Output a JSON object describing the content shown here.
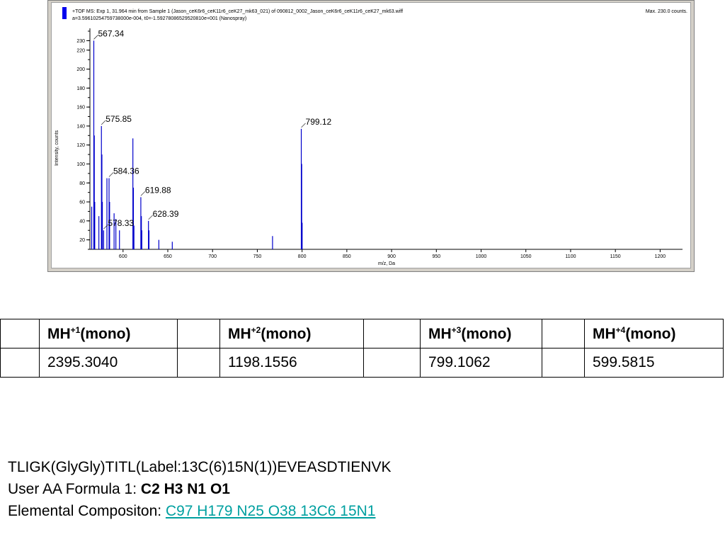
{
  "spectrum": {
    "header_line1": "+TOF MS: Exp 1, 31.964 min from Sample 1 (Jason_ceK6r6_ceK11r6_ceK27_mk63_021) of 090812_0002_Jason_ceK6r6_ceK11r6_ceK27_mk63.wiff",
    "header_line2": "a=3.59610254759738000e-004, t0=-1.59278086529520810e+001 (Nanospray)",
    "max_label": "Max. 230.0 counts.",
    "ylabel": "Intensity, counts",
    "xlabel": "m/z, Da"
  },
  "chart_data": {
    "type": "line",
    "title": "+TOF MS: Exp 1, 31.964 min from Sample 1",
    "xlabel": "m/z, Da",
    "ylabel": "Intensity, counts",
    "xlim": [
      563,
      1225
    ],
    "ylim": [
      10,
      240
    ],
    "x_ticks": [
      600,
      650,
      700,
      750,
      800,
      850,
      900,
      950,
      1000,
      1050,
      1100,
      1150,
      1200
    ],
    "y_ticks": [
      20,
      40,
      60,
      80,
      100,
      120,
      140,
      160,
      180,
      200,
      220,
      230
    ],
    "peaks": [
      {
        "mz": 565.0,
        "intensity": 55
      },
      {
        "mz": 567.34,
        "intensity": 230
      },
      {
        "mz": 567.9,
        "intensity": 130
      },
      {
        "mz": 568.4,
        "intensity": 60
      },
      {
        "mz": 573.0,
        "intensity": 45
      },
      {
        "mz": 575.85,
        "intensity": 140
      },
      {
        "mz": 576.4,
        "intensity": 110
      },
      {
        "mz": 576.9,
        "intensity": 60
      },
      {
        "mz": 578.33,
        "intensity": 30
      },
      {
        "mz": 582.0,
        "intensity": 85
      },
      {
        "mz": 584.36,
        "intensity": 85
      },
      {
        "mz": 585.0,
        "intensity": 60
      },
      {
        "mz": 590.0,
        "intensity": 48
      },
      {
        "mz": 592.0,
        "intensity": 42
      },
      {
        "mz": 596.0,
        "intensity": 30
      },
      {
        "mz": 611.0,
        "intensity": 127
      },
      {
        "mz": 611.6,
        "intensity": 75
      },
      {
        "mz": 612.2,
        "intensity": 35
      },
      {
        "mz": 619.88,
        "intensity": 65
      },
      {
        "mz": 620.5,
        "intensity": 45
      },
      {
        "mz": 621.0,
        "intensity": 30
      },
      {
        "mz": 628.39,
        "intensity": 40
      },
      {
        "mz": 629.0,
        "intensity": 30
      },
      {
        "mz": 640.0,
        "intensity": 20
      },
      {
        "mz": 655.0,
        "intensity": 18
      },
      {
        "mz": 767.0,
        "intensity": 24
      },
      {
        "mz": 799.12,
        "intensity": 137
      },
      {
        "mz": 799.6,
        "intensity": 100
      },
      {
        "mz": 800.1,
        "intensity": 38
      }
    ],
    "annotations": [
      {
        "text": "567.34",
        "mz": 567.34,
        "intensity": 230
      },
      {
        "text": "575.85",
        "mz": 575.85,
        "intensity": 140
      },
      {
        "text": "584.36",
        "mz": 584.36,
        "intensity": 85
      },
      {
        "text": "619.88",
        "mz": 619.88,
        "intensity": 65
      },
      {
        "text": "628.39",
        "mz": 628.39,
        "intensity": 40
      },
      {
        "text": "578.33",
        "mz": 578.33,
        "intensity": 30
      },
      {
        "text": "799.12",
        "mz": 799.12,
        "intensity": 137
      }
    ],
    "series_color": "#0000cc"
  },
  "table": {
    "headers": [
      {
        "base": "MH",
        "sup": "+1",
        "suffix": "(mono)"
      },
      {
        "base": "MH",
        "sup": "+2",
        "suffix": "(mono)"
      },
      {
        "base": "MH",
        "sup": "+3",
        "suffix": "(mono)"
      },
      {
        "base": "MH",
        "sup": "+4",
        "suffix": "(mono)"
      }
    ],
    "values": [
      "2395.3040",
      "1198.1556",
      "799.1062",
      "599.5815"
    ]
  },
  "info": {
    "sequence": "TLIGK(GlyGly)TITL(Label:13C(6)15N(1))EVEASDTIENVK",
    "formula_label": "User AA Formula 1: ",
    "formula_value": "C2 H3 N1 O1",
    "composition_label": "Elemental Compositon: ",
    "composition_value": "C97 H179 N25 O38 13C6 15N1"
  }
}
